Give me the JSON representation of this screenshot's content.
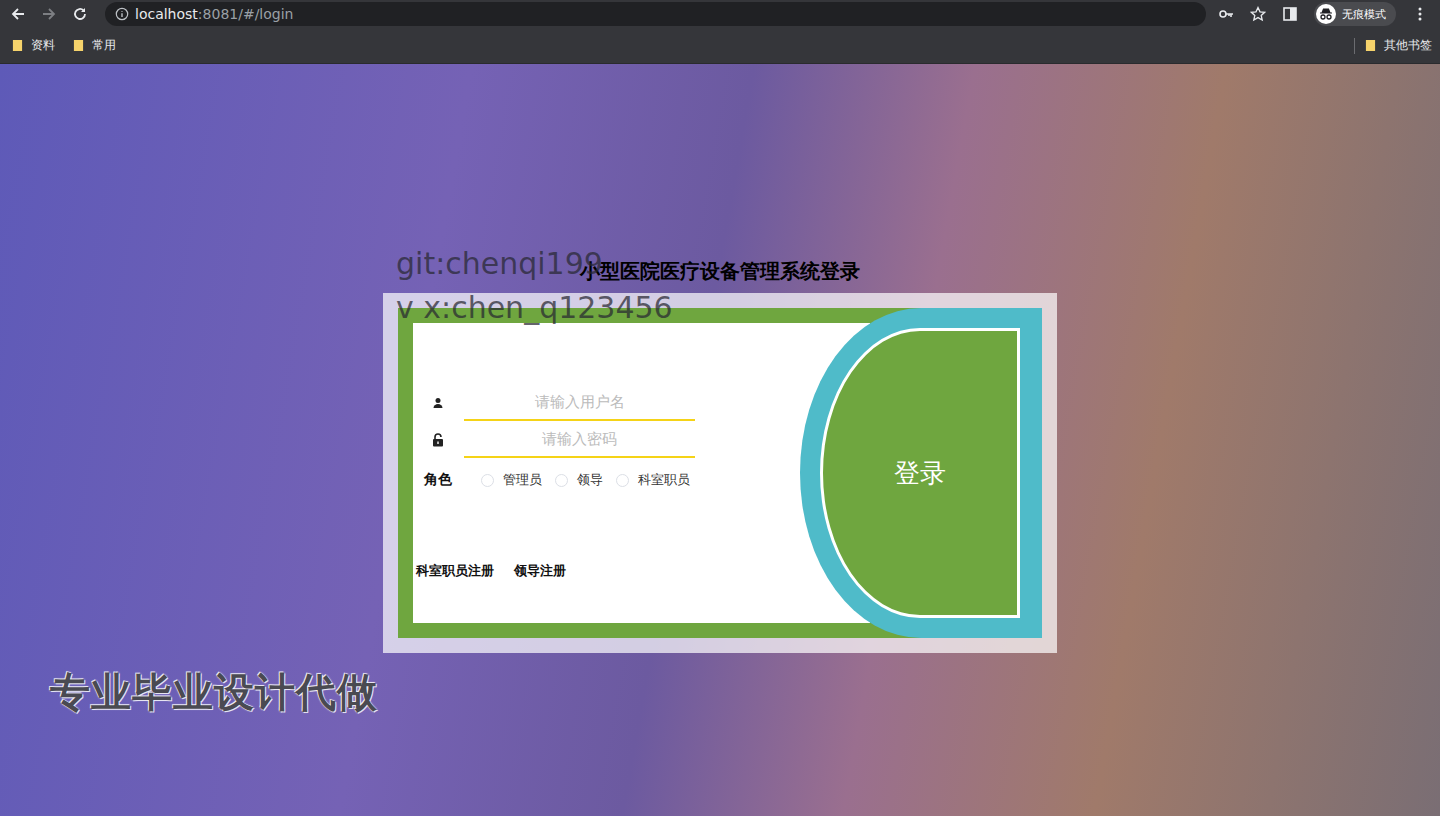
{
  "browser": {
    "nav": {
      "back_enabled": true,
      "forward_enabled": false
    },
    "address": {
      "host": "localhost",
      "path": ":8081/#/login"
    },
    "profile": {
      "label": "无痕模式"
    },
    "bookmarks": [
      {
        "label": "资料"
      },
      {
        "label": "常用"
      }
    ],
    "other_bookmarks": {
      "label": "其他书签"
    }
  },
  "watermarks": {
    "top": [
      "git:chenqi199",
      "v x:chen_q123456"
    ],
    "bottom": "专业毕业设计代做"
  },
  "login": {
    "title": "小型医院医疗设备管理系统登录",
    "username_placeholder": "请输入用户名",
    "password_placeholder": "请输入密码",
    "role_label": "角色",
    "roles": [
      {
        "label": "管理员",
        "selected": false
      },
      {
        "label": "领导",
        "selected": false
      },
      {
        "label": "科室职员",
        "selected": false
      }
    ],
    "links": [
      "科室职员注册",
      "领导注册"
    ],
    "submit": "登录"
  }
}
